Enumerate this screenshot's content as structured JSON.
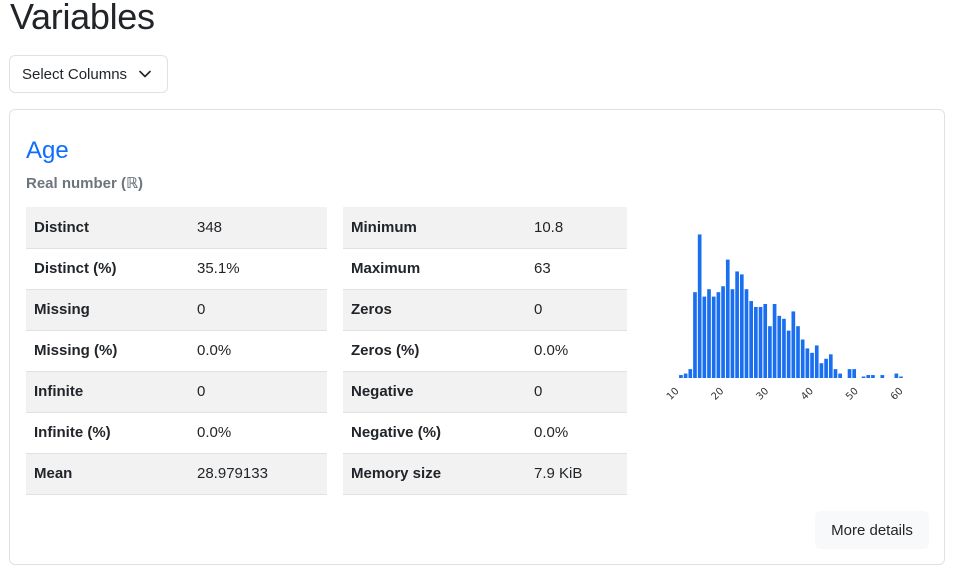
{
  "page": {
    "title": "Variables"
  },
  "select_columns": {
    "label": "Select Columns"
  },
  "variable": {
    "name": "Age",
    "type": "Real number (ℝ)",
    "stats_left": [
      {
        "label": "Distinct",
        "value": "348"
      },
      {
        "label": "Distinct (%)",
        "value": "35.1%"
      },
      {
        "label": "Missing",
        "value": "0"
      },
      {
        "label": "Missing (%)",
        "value": "0.0%"
      },
      {
        "label": "Infinite",
        "value": "0"
      },
      {
        "label": "Infinite (%)",
        "value": "0.0%"
      },
      {
        "label": "Mean",
        "value": "28.979133"
      }
    ],
    "stats_right": [
      {
        "label": "Minimum",
        "value": "10.8"
      },
      {
        "label": "Maximum",
        "value": "63"
      },
      {
        "label": "Zeros",
        "value": "0"
      },
      {
        "label": "Zeros (%)",
        "value": "0.0%"
      },
      {
        "label": "Negative",
        "value": "0"
      },
      {
        "label": "Negative (%)",
        "value": "0.0%"
      },
      {
        "label": "Memory size",
        "value": "7.9 KiB"
      }
    ],
    "more_details_label": "More details"
  },
  "colors": {
    "accent": "#0d6efd",
    "bar": "#1a6ff0"
  },
  "chart_data": {
    "type": "bar",
    "xlim": [
      10,
      64
    ],
    "xticks": [
      10,
      20,
      30,
      40,
      50,
      60
    ],
    "bin_start": 10.8,
    "bin_width": 1.045,
    "ylim": [
      0,
      100
    ],
    "values": [
      2,
      3,
      6,
      58,
      97,
      55,
      60,
      55,
      58,
      62,
      80,
      60,
      72,
      70,
      60,
      52,
      48,
      48,
      50,
      35,
      50,
      42,
      40,
      32,
      45,
      35,
      26,
      20,
      17,
      22,
      10,
      13,
      16,
      6,
      3,
      0,
      6,
      6,
      0,
      1,
      2,
      2,
      0,
      2,
      0,
      0,
      3,
      1
    ]
  }
}
